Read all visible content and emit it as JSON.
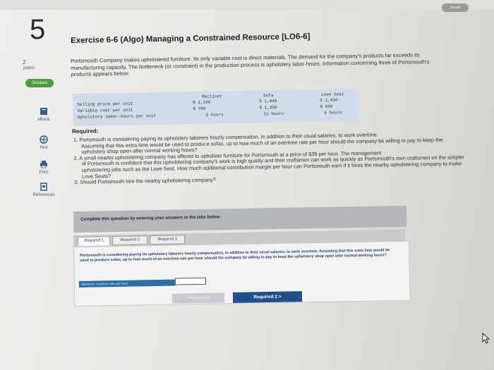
{
  "header": {
    "saved_label": "Saved"
  },
  "sidebar": {
    "question_number": "5",
    "points_value": "2",
    "points_label": "points",
    "status_badge": "Skipped",
    "tools": [
      {
        "label": "eBook",
        "icon": "book-icon"
      },
      {
        "label": "Hint",
        "icon": "hint-icon"
      },
      {
        "label": "Print",
        "icon": "print-icon"
      },
      {
        "label": "References",
        "icon": "references-icon"
      }
    ]
  },
  "exercise": {
    "title": "Exercise 6-6 (Algo) Managing a Constrained Resource [LO6-6]",
    "intro": "Portsmouth Company makes upholstered furniture. Its only variable cost is direct materials. The demand for the company's products far exceeds its manufacturing capacity. The bottleneck (or constraint) in the production process is upholstery labor-hours. Information concerning three of Portsmouth's products appears below:"
  },
  "table": {
    "columns": [
      "Recliner",
      "Sofa",
      "Love Seat"
    ],
    "rows": [
      {
        "label": "Selling price per unit",
        "values": [
          "$ 1,240",
          "$ 1,845",
          "$ 1,430"
        ]
      },
      {
        "label": "Variable cost per unit",
        "values": [
          "$ 700",
          "$ 1,350",
          "$ 950"
        ]
      },
      {
        "label": "Upholstery labor-hours per unit",
        "values": [
          "9 hours",
          "11 hours",
          "6 hours"
        ]
      }
    ]
  },
  "requirements": {
    "heading": "Required:",
    "items": [
      {
        "first": "1. Portsmouth is considering paying its upholstery laborers hourly compensation, in addition to their usual salaries, to work overtime.",
        "rest": "Assuming that this extra time would be used to produce sofas, up to how much of an overtime rate per hour should the company be willing to pay to keep the upholstery shop open after normal working hours?"
      },
      {
        "first": "2. A small nearby upholstering company has offered to upholster furniture for Portsmouth at a price of $39 per hour. The management",
        "rest": "of Portsmouth is confident that this upholstering company's work is high quality and their craftsmen can work as quickly as Portsmouth's own craftsmen on the simpler upholstering jobs such as the Love Seat. How much additional contribution margin per hour can Portsmouth earn if it hires the nearby upholstering company to make Love Seats?"
      },
      {
        "first": "3. Should Portsmouth hire the nearby upholstering company?",
        "rest": ""
      }
    ]
  },
  "instructions": "Complete this question by entering your answers in the tabs below.",
  "tabs": [
    "Required 1",
    "Required 2",
    "Required 3"
  ],
  "active_tab": {
    "text": "Portsmouth is considering paying its upholstery laborers hourly compensation, in addition to their usual salaries, to work overtime. Assuming that this extra time would be used to produce sofas, up to how much of an overtime rate per hour should the company be willing to pay to keep the upholstery shop open after normal working hours?",
    "answer_label": "Maximum overtime rate per hour",
    "answer_value": ""
  },
  "navigation": {
    "prev_label": "< Required 1",
    "next_label": "Required 2 >"
  }
}
